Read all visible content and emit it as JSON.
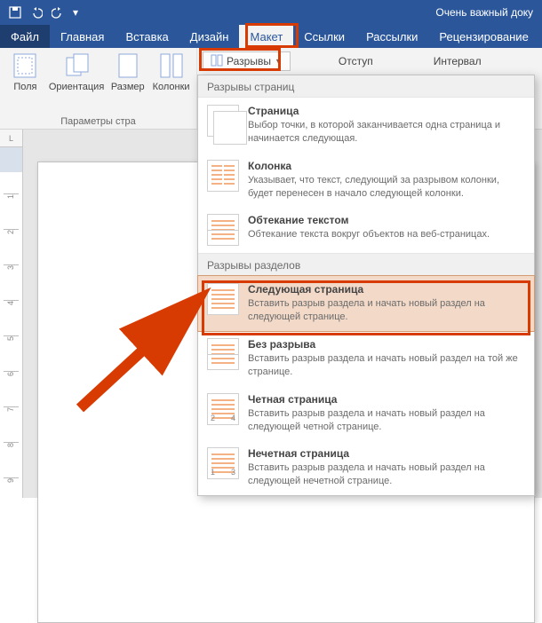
{
  "title": "Очень важный докy",
  "tabs": {
    "file": "Файл",
    "items": [
      "Главная",
      "Вставка",
      "Дизайн",
      "Макет",
      "Ссылки",
      "Рассылки",
      "Рецензирование"
    ],
    "active_index": 3
  },
  "ribbon": {
    "group1": {
      "label": "Параметры стра",
      "items": [
        {
          "label": "Поля"
        },
        {
          "label": "Ориентация"
        },
        {
          "label": "Размер"
        },
        {
          "label": "Колонки"
        }
      ]
    },
    "breaks_btn": "Разрывы",
    "indent": "Отступ",
    "interval": "Интервал"
  },
  "dropdown": {
    "section1": "Разрывы страниц",
    "section2": "Разрывы разделов",
    "items1": [
      {
        "title": "Страница",
        "desc": "Выбор точки, в которой заканчивается одна страница и начинается следующая."
      },
      {
        "title": "Колонка",
        "desc": "Указывает, что текст, следующий за разрывом колонки, будет перенесен в начало следующей колонки."
      },
      {
        "title": "Обтекание текстом",
        "desc": "Обтекание текста вокруг объектов на веб-страницах."
      }
    ],
    "items2": [
      {
        "title": "Следующая страница",
        "desc": "Вставить разрыв раздела и начать новый раздел на следующей странице."
      },
      {
        "title": "Без разрыва",
        "desc": "Вставить разрыв раздела и начать новый раздел на той же странице."
      },
      {
        "title": "Четная страница",
        "desc": "Вставить разрыв раздела и начать новый раздел на следующей четной странице."
      },
      {
        "title": "Нечетная страница",
        "desc": "Вставить разрыв раздела и начать новый раздел на следующей нечетной странице."
      }
    ]
  },
  "ruler_corner": "L"
}
